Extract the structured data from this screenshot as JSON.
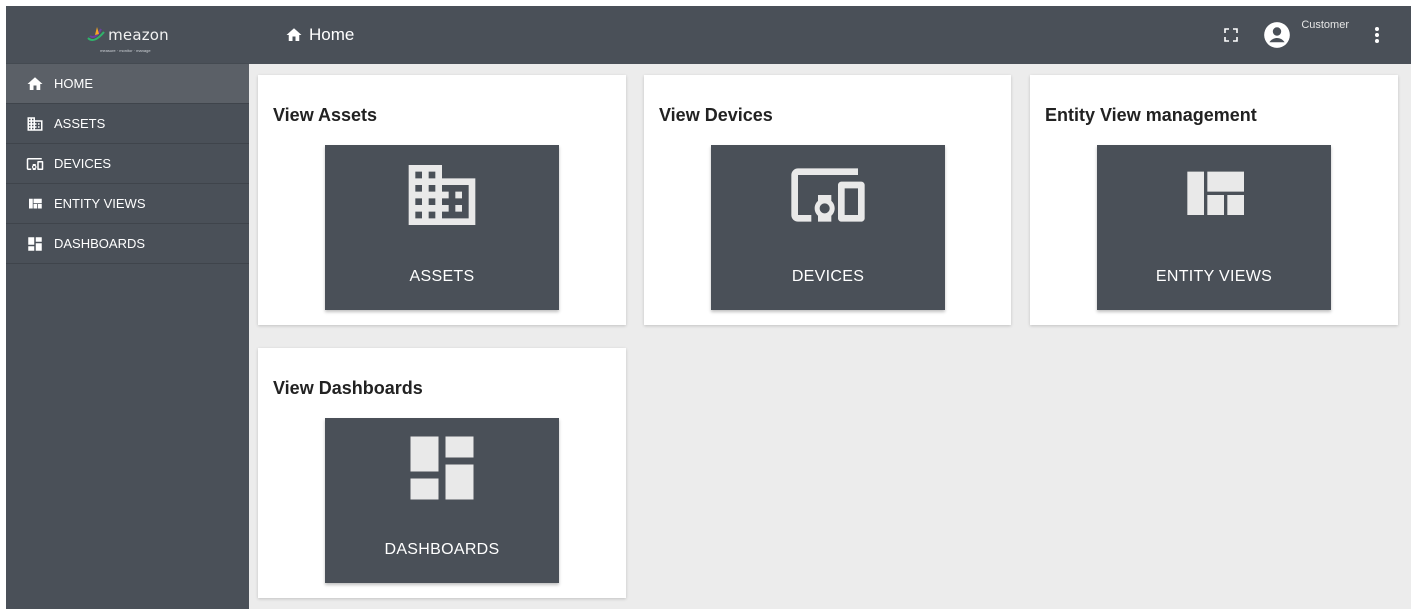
{
  "app": {
    "logo_text": "meazon",
    "logo_tagline": "measure · monitor · manage"
  },
  "sidebar": {
    "items": [
      {
        "label": "HOME",
        "icon": "home-icon",
        "active": true
      },
      {
        "label": "ASSETS",
        "icon": "domain-icon",
        "active": false
      },
      {
        "label": "DEVICES",
        "icon": "devices-other-icon",
        "active": false
      },
      {
        "label": "ENTITY VIEWS",
        "icon": "view-quilt-icon",
        "active": false
      },
      {
        "label": "DASHBOARDS",
        "icon": "dashboard-icon",
        "active": false
      }
    ]
  },
  "header": {
    "title": "Home",
    "user_label": "Customer"
  },
  "cards": [
    {
      "title": "View Assets",
      "tile_label": "ASSETS",
      "icon": "domain-icon"
    },
    {
      "title": "View Devices",
      "tile_label": "DEVICES",
      "icon": "devices-other-icon"
    },
    {
      "title": "Entity View management",
      "tile_label": "ENTITY VIEWS",
      "icon": "view-quilt-icon"
    },
    {
      "title": "View Dashboards",
      "tile_label": "DASHBOARDS",
      "icon": "dashboard-icon"
    }
  ],
  "colors": {
    "sidebar": "#4a5058",
    "active_item": "#5b6067",
    "content_bg": "#ececec",
    "tile": "#4a5058",
    "logo_accent_orange": "#f5a623",
    "logo_accent_purple": "#6b3fa0",
    "logo_accent_green": "#2fb36b"
  }
}
